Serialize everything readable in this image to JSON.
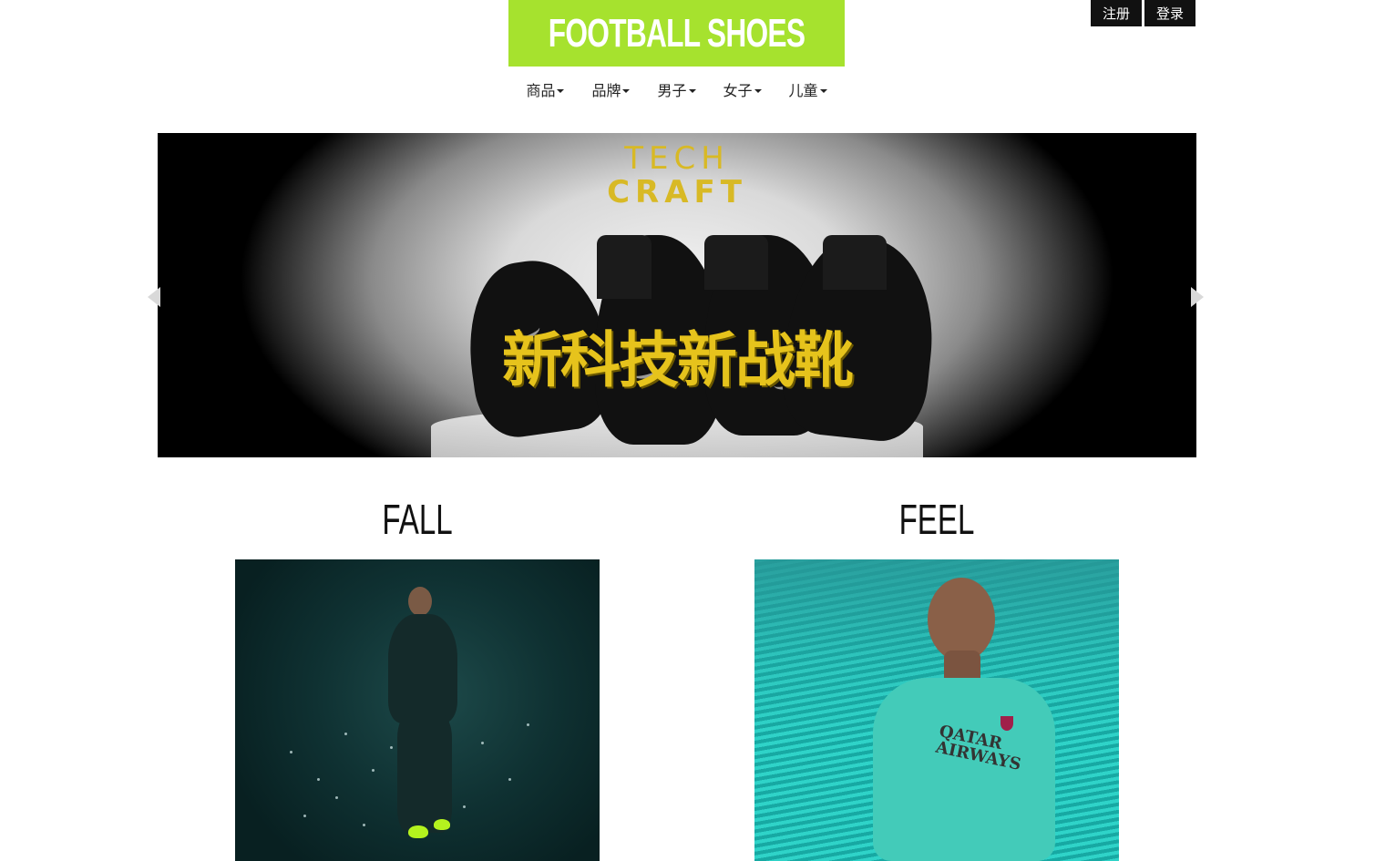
{
  "logo": {
    "text": "FOOTBALL SHOES",
    "color": "#a6e22e"
  },
  "auth": {
    "register_label": "注册",
    "login_label": "登录"
  },
  "nav": {
    "items": [
      {
        "label": "商品"
      },
      {
        "label": "品牌"
      },
      {
        "label": "男子"
      },
      {
        "label": "女子"
      },
      {
        "label": "儿童"
      }
    ]
  },
  "carousel": {
    "title_line1": "TECH",
    "title_line2": "CRAFT",
    "slogan": "新科技新战靴",
    "accent_color": "#d8b925",
    "prev_icon": "chevron-left-icon",
    "next_icon": "chevron-right-icon"
  },
  "features": [
    {
      "title": "FALL"
    },
    {
      "title": "FEEL",
      "jersey_text": "QATAR AIRWAYS"
    }
  ]
}
